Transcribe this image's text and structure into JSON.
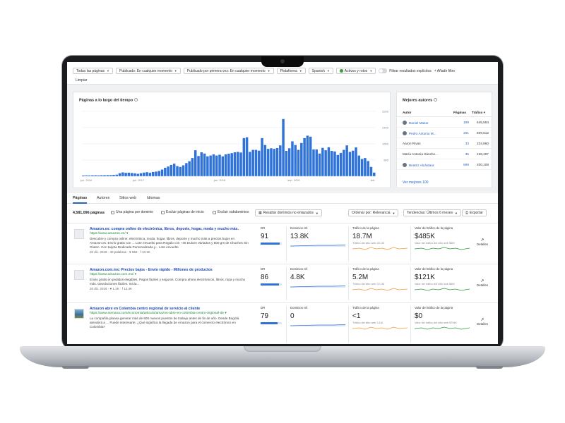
{
  "filters": {
    "items": [
      "Todas las páginas",
      "Publicado: En cualquier momento",
      "Publicado por primera vez: En cualquier momento",
      "Plataforma",
      "Spanish",
      "Activos y rotos"
    ],
    "explicit_toggle_label": "Filtrar resultados explícitos",
    "add_filter_label": "+ Añadir filtro",
    "clear_label": "Limpiar"
  },
  "chart_panel": {
    "title": "Páginas a lo largo del tiempo"
  },
  "chart_data": {
    "type": "bar",
    "ylim": [
      0,
      3300
    ],
    "y_ticks": [
      "3200",
      "2400",
      "1600",
      "800"
    ],
    "x_labels": [
      "jun. 2016",
      "jan. 2017",
      "jan. 2018",
      "sep. 2020",
      "feb."
    ],
    "values": [
      40,
      45,
      42,
      48,
      50,
      46,
      52,
      55,
      58,
      60,
      70,
      80,
      150,
      190,
      170,
      175,
      160,
      145,
      120,
      150,
      180,
      200,
      170,
      210,
      230,
      260,
      330,
      420,
      480,
      560,
      620,
      500,
      460,
      540,
      650,
      740,
      900,
      1280,
      1000,
      1180,
      1120,
      980,
      1020,
      1080,
      1020,
      1060,
      980,
      1080,
      1110,
      1140,
      1180,
      1200,
      1170,
      1880,
      1920,
      1200,
      1300,
      1300,
      1260,
      1880,
      1540,
      1350,
      1380,
      1350,
      1390,
      1520,
      2820,
      1250,
      1380,
      1720,
      1540,
      1300,
      1640,
      1880,
      2000,
      1950,
      1320,
      1320,
      1120,
      1400,
      1280,
      1430,
      1250,
      1220,
      1050,
      1150,
      1300,
      1520,
      1200,
      1260,
      1420,
      1020,
      850,
      900,
      750,
      460,
      180
    ],
    "grid": true
  },
  "authors": {
    "title": "Mejores autores",
    "col_author": "Autor",
    "col_pages": "Páginas",
    "col_traffic": "Tráfico ▾",
    "rows": [
      {
        "name": "Daniel Matus",
        "pages": "199",
        "traffic": "645,553",
        "link": true,
        "avatar": true
      },
      {
        "name": "Pedro Antonio M...",
        "pages": "201",
        "traffic": "609,512",
        "link": true,
        "avatar": true
      },
      {
        "name": "Aaron Rivas",
        "pages": "33",
        "traffic": "234,860",
        "link": false,
        "avatar": false
      },
      {
        "name": "María Antonia Sánche...",
        "pages": "35",
        "traffic": "228,497",
        "link": false,
        "avatar": false
      },
      {
        "name": "Beatriz Alcántara",
        "pages": "699",
        "traffic": "200,108",
        "link": true,
        "avatar": true
      }
    ],
    "see_more": "Ver mejores 100"
  },
  "tabs": [
    "Páginas",
    "Autores",
    "Sitios web",
    "Idiomas"
  ],
  "toolbar": {
    "count": "4,581,096 páginas",
    "one_per_domain": "Una página por dominio",
    "exclude_home": "Excluir páginas de inicio",
    "exclude_subdomains": "Excluir subdominios",
    "highlight": "Resaltar dominios no enlazados",
    "sort": "Ordenar por: Relevancia",
    "trends": "Tendencias: Últimos 6 meses",
    "export": "Exportar"
  },
  "metric_labels": {
    "dr": "DR",
    "ref_domains": "Dominios ref.",
    "traffic": "Tráfico de la página",
    "value": "Valor del tráfico de la página",
    "details": "Detalles"
  },
  "results": [
    {
      "title": "Amazon.es: compra online de electrónica, libros, deporte, hogar, moda y mucho más.",
      "url": "https://www.amazon.es/ ▾",
      "desc": "Descubre y compra online: electrónica, moda, hogar, libros, deporte y mucho más a precios bajos en Amazon.es. Envío gratis con ... Lote envuelto para Regalo con ~45 Dulces Variados y 500 grs de Chuches Sin Gluten. Con tarjeta Dedicada Personalizada y... Lote envuelto",
      "meta": "20 dic. 2018 · 40 palabras · ♥ 552 · f 10.1K",
      "dr": "91",
      "dr_fill": 0.91,
      "ref_domains": "13.8K",
      "traffic": "18.7M",
      "traffic_sub": "Tráfico del sitio web 46.1M",
      "value": "$485K",
      "value_sub": "Valor del tráfico del sitio web $6M",
      "has_image": false
    },
    {
      "title": "Amazon.com.mx: Precios bajos - Envío rápido - Millones de productos",
      "url": "https://www.amazon.com.mx/ ▾",
      "desc": "Envío gratis en pedidos elegibles. Pagos fáciles y seguros. Compra ahora electrónicos, libros, ropa y mucho más. Devoluciones fáciles. Inicia...",
      "meta": "20 dic. 2018 · ♥ 1.2K · f 12.4K",
      "dr": "86",
      "dr_fill": 0.86,
      "ref_domains": "4.8K",
      "traffic": "5.2M",
      "traffic_sub": "Tráfico del sitio web 22.1M",
      "value": "$121K",
      "value_sub": "Valor del tráfico del sitio web $6M",
      "has_image": false
    },
    {
      "title": "Amazon abre en Colombia centro regional de servicio al cliente",
      "url": "https://www.semana.com/economia/articulo/amazon-abre-en-colombia-centro-regional-de ▾",
      "desc": "La compañía planea generar más de 600 nuevos puestos de trabajo antes de fin de año. Desde Bogotá atenderá a ... Puede interesarte: ¿Qué significa la llegada de Amazon para el comercio electrónico en Colombia?",
      "meta": "",
      "dr": "79",
      "dr_fill": 0.79,
      "ref_domains": "0",
      "traffic": "<1",
      "traffic_sub": "Tráfico del sitio web 3.1M",
      "value": "$0",
      "value_sub": "Valor del tráfico del sitio web $794K",
      "has_image": true
    }
  ]
}
